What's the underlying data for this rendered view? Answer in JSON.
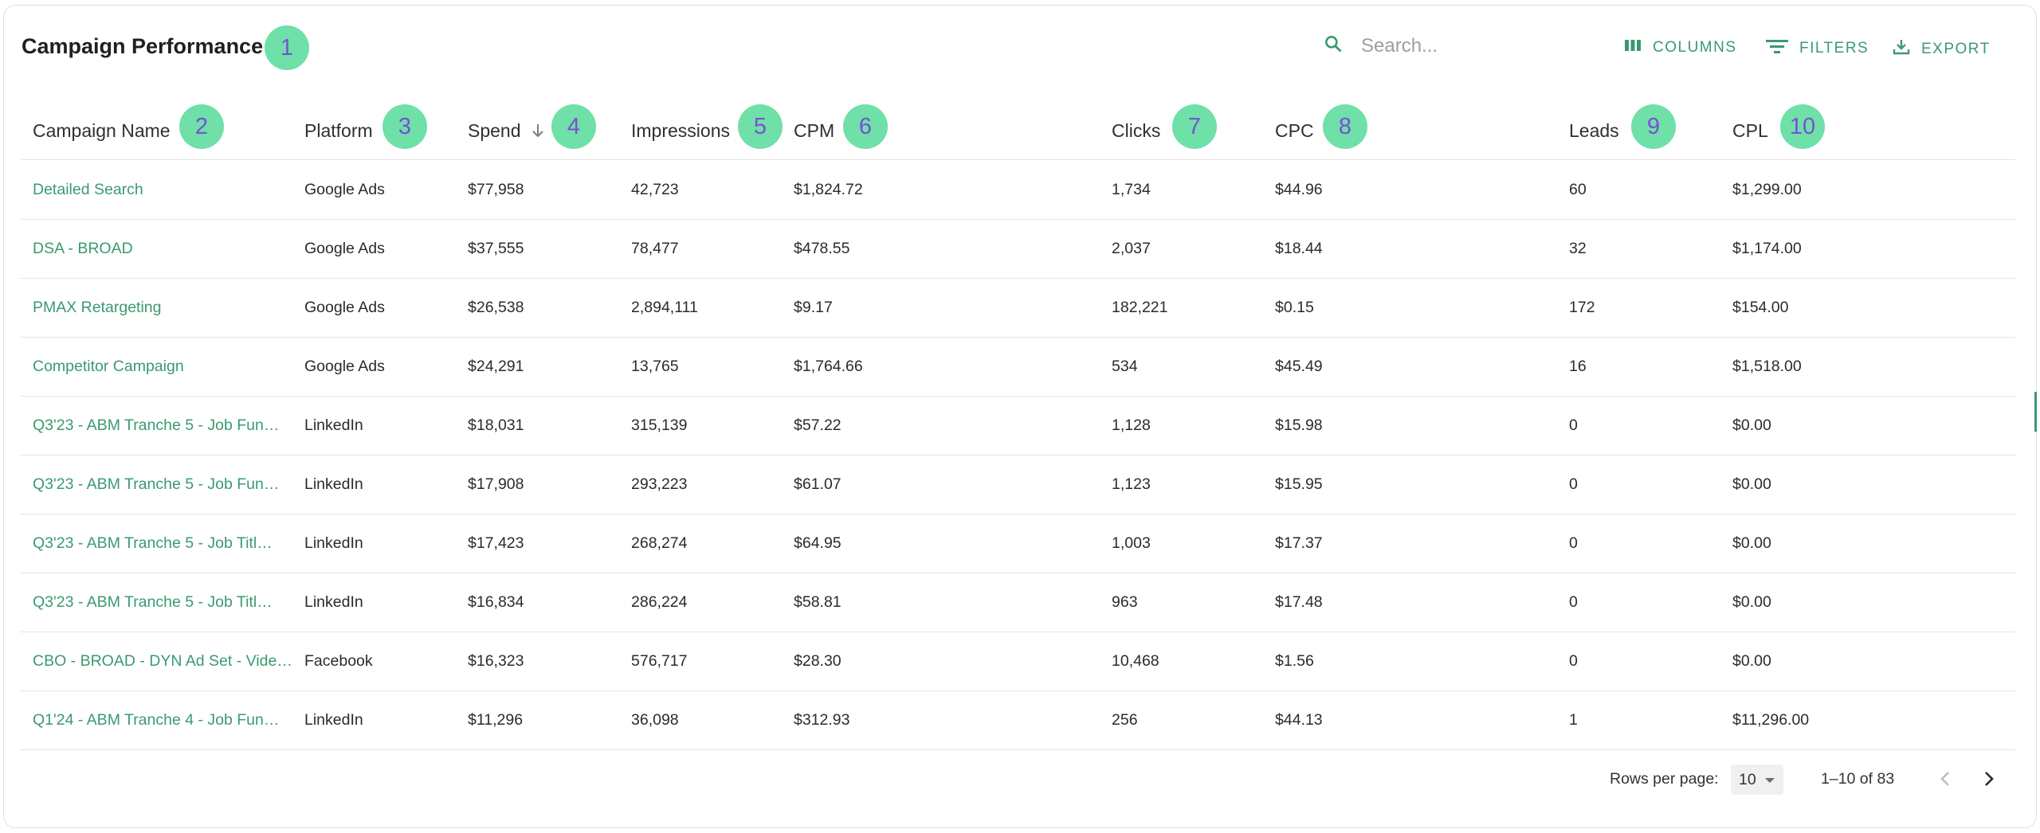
{
  "title": "Campaign Performance",
  "search": {
    "placeholder": "Search..."
  },
  "toolbar": {
    "columns": "COLUMNS",
    "filters": "FILTERS",
    "export": "EXPORT"
  },
  "badges": [
    "1",
    "2",
    "3",
    "4",
    "5",
    "6",
    "7",
    "8",
    "9",
    "10"
  ],
  "columns": {
    "name": "Campaign Name",
    "platform": "Platform",
    "spend": "Spend",
    "impressions": "Impressions",
    "cpm": "CPM",
    "clicks": "Clicks",
    "cpc": "CPC",
    "leads": "Leads",
    "cpl": "CPL"
  },
  "sort": {
    "column": "spend",
    "direction": "descending",
    "icon": "arrow-down-icon"
  },
  "rows": [
    {
      "name": "Detailed Search",
      "platform": "Google Ads",
      "spend": "$77,958",
      "impressions": "42,723",
      "cpm": "$1,824.72",
      "clicks": "1,734",
      "cpc": "$44.96",
      "leads": "60",
      "cpl": "$1,299.00"
    },
    {
      "name": "DSA - BROAD",
      "platform": "Google Ads",
      "spend": "$37,555",
      "impressions": "78,477",
      "cpm": "$478.55",
      "clicks": "2,037",
      "cpc": "$18.44",
      "leads": "32",
      "cpl": "$1,174.00"
    },
    {
      "name": "PMAX Retargeting",
      "platform": "Google Ads",
      "spend": "$26,538",
      "impressions": "2,894,111",
      "cpm": "$9.17",
      "clicks": "182,221",
      "cpc": "$0.15",
      "leads": "172",
      "cpl": "$154.00"
    },
    {
      "name": "Competitor Campaign",
      "platform": "Google Ads",
      "spend": "$24,291",
      "impressions": "13,765",
      "cpm": "$1,764.66",
      "clicks": "534",
      "cpc": "$45.49",
      "leads": "16",
      "cpl": "$1,518.00"
    },
    {
      "name": "Q3'23 - ABM Tranche 5 - Job Fun…",
      "platform": "LinkedIn",
      "spend": "$18,031",
      "impressions": "315,139",
      "cpm": "$57.22",
      "clicks": "1,128",
      "cpc": "$15.98",
      "leads": "0",
      "cpl": "$0.00"
    },
    {
      "name": "Q3'23 - ABM Tranche 5 - Job Fun…",
      "platform": "LinkedIn",
      "spend": "$17,908",
      "impressions": "293,223",
      "cpm": "$61.07",
      "clicks": "1,123",
      "cpc": "$15.95",
      "leads": "0",
      "cpl": "$0.00"
    },
    {
      "name": "Q3'23 - ABM Tranche 5 - Job Titl…",
      "platform": "LinkedIn",
      "spend": "$17,423",
      "impressions": "268,274",
      "cpm": "$64.95",
      "clicks": "1,003",
      "cpc": "$17.37",
      "leads": "0",
      "cpl": "$0.00"
    },
    {
      "name": "Q3'23 - ABM Tranche 5 - Job Titl…",
      "platform": "LinkedIn",
      "spend": "$16,834",
      "impressions": "286,224",
      "cpm": "$58.81",
      "clicks": "963",
      "cpc": "$17.48",
      "leads": "0",
      "cpl": "$0.00"
    },
    {
      "name": "CBO - BROAD - DYN Ad Set - Vide…",
      "platform": "Facebook",
      "spend": "$16,323",
      "impressions": "576,717",
      "cpm": "$28.30",
      "clicks": "10,468",
      "cpc": "$1.56",
      "leads": "0",
      "cpl": "$0.00"
    },
    {
      "name": "Q1'24 - ABM Tranche 4 - Job Fun…",
      "platform": "LinkedIn",
      "spend": "$11,296",
      "impressions": "36,098",
      "cpm": "$312.93",
      "clicks": "256",
      "cpc": "$44.13",
      "leads": "1",
      "cpl": "$11,296.00"
    }
  ],
  "pagination": {
    "rows_per_page_label": "Rows per page:",
    "rows_per_page_value": "10",
    "range_text": "1–10 of 83"
  },
  "colors": {
    "accent": "#3a9a70",
    "badge_bg": "#6ee0a8",
    "badge_text": "#7a4fd6"
  }
}
